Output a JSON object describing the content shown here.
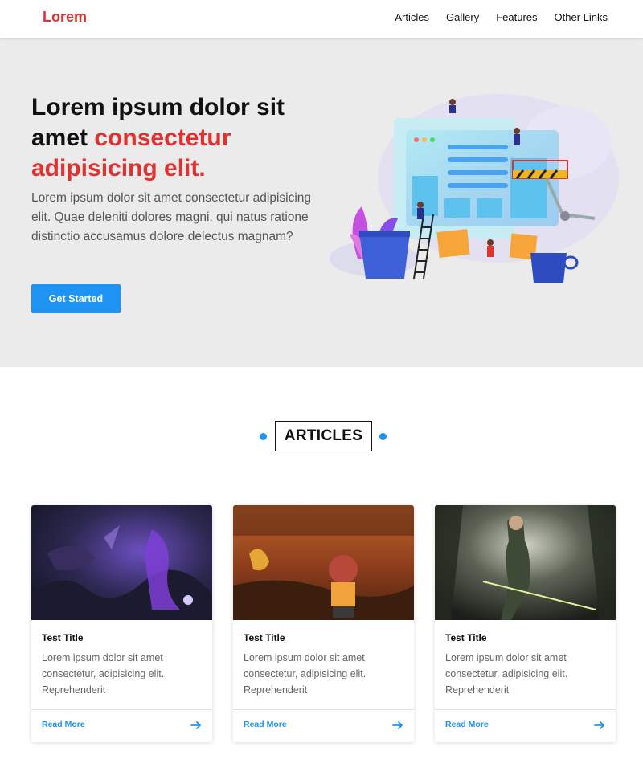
{
  "nav": {
    "logo": "Lorem",
    "links": [
      "Articles",
      "Gallery",
      "Features",
      "Other Links"
    ]
  },
  "hero": {
    "title_plain": "Lorem ipsum dolor sit amet ",
    "title_accent": "consectetur adipisicing elit.",
    "text": "Lorem ipsum dolor sit amet consectetur adipisicing elit. Quae deleniti dolores magni, qui natus ratione distinctio accusamus dolore delectus magnam?",
    "cta_label": "Get Started"
  },
  "articles": {
    "heading": "ARTICLES",
    "cards": [
      {
        "title": "Test Title",
        "text": "Lorem ipsum dolor sit amet consectetur, adipisicing elit. Reprehenderit",
        "link": "Read More"
      },
      {
        "title": "Test Title",
        "text": "Lorem ipsum dolor sit amet consectetur, adipisicing elit. Reprehenderit",
        "link": "Read More"
      },
      {
        "title": "Test Title",
        "text": "Lorem ipsum dolor sit amet consectetur, adipisicing elit. Reprehenderit",
        "link": "Read More"
      }
    ]
  },
  "colors": {
    "brand_red": "#e0312f",
    "accent_blue": "#1e93f1",
    "hero_bg": "#ebebeb"
  }
}
